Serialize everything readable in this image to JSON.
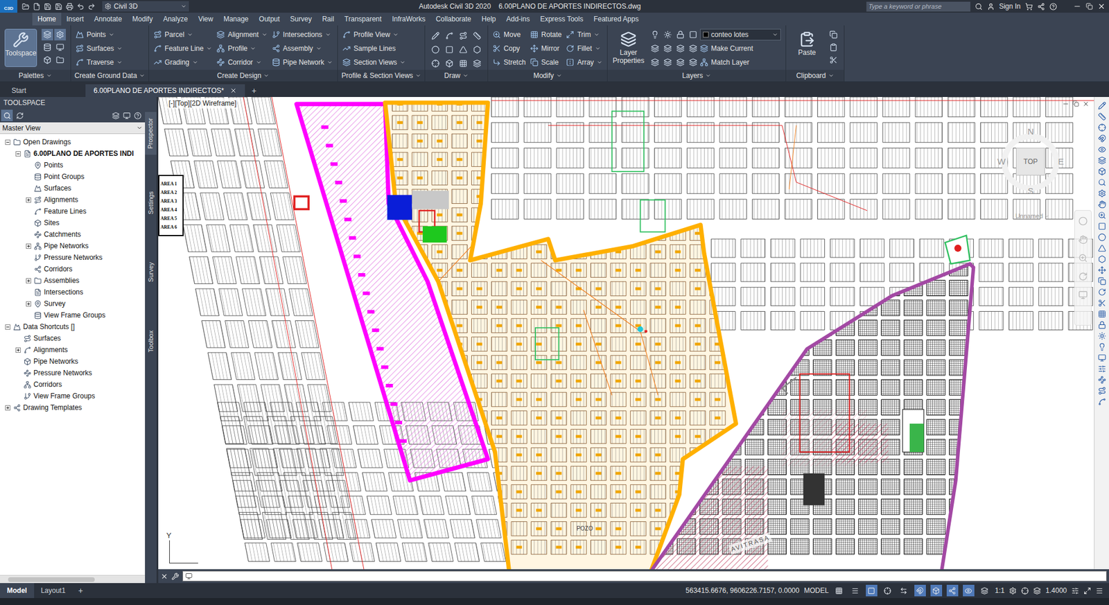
{
  "title_bar": {
    "app_logo": "C3D",
    "workspace": "Civil 3D",
    "title": "Autodesk Civil 3D 2020    6.00PLANO DE APORTES INDIRECTOS.dwg",
    "search_placeholder": "Type a keyword or phrase",
    "sign_in": "Sign In"
  },
  "ribbon_tabs": [
    {
      "label": "Home",
      "selected": true
    },
    {
      "label": "Insert",
      "selected": false
    },
    {
      "label": "Annotate",
      "selected": false
    },
    {
      "label": "Modify",
      "selected": false
    },
    {
      "label": "Analyze",
      "selected": false
    },
    {
      "label": "View",
      "selected": false
    },
    {
      "label": "Manage",
      "selected": false
    },
    {
      "label": "Output",
      "selected": false
    },
    {
      "label": "Survey",
      "selected": false
    },
    {
      "label": "Rail",
      "selected": false
    },
    {
      "label": "Transparent",
      "selected": false
    },
    {
      "label": "InfraWorks",
      "selected": false
    },
    {
      "label": "Collaborate",
      "selected": false
    },
    {
      "label": "Help",
      "selected": false
    },
    {
      "label": "Add-ins",
      "selected": false
    },
    {
      "label": "Express Tools",
      "selected": false
    },
    {
      "label": "Featured Apps",
      "selected": false
    }
  ],
  "ribbon_panels": [
    {
      "title": "Palettes",
      "kind": "palettes",
      "big": {
        "label": "Toolspace",
        "selected": true
      }
    },
    {
      "title": "Create Ground Data",
      "kind": "tools",
      "columns": [
        [
          {
            "label": "Points",
            "dropdown": true
          },
          {
            "label": "Surfaces",
            "dropdown": true
          },
          {
            "label": "Traverse",
            "dropdown": true
          }
        ]
      ]
    },
    {
      "title": "Create Design",
      "kind": "tools",
      "columns": [
        [
          {
            "label": "Parcel",
            "dropdown": true
          },
          {
            "label": "Feature Line",
            "dropdown": true
          },
          {
            "label": "Grading",
            "dropdown": true
          }
        ],
        [
          {
            "label": "Alignment",
            "dropdown": true
          },
          {
            "label": "Profile",
            "dropdown": true
          },
          {
            "label": "Corridor",
            "dropdown": true
          }
        ],
        [
          {
            "label": "Intersections",
            "dropdown": true
          },
          {
            "label": "Assembly",
            "dropdown": true
          },
          {
            "label": "Pipe Network",
            "dropdown": true
          }
        ]
      ]
    },
    {
      "title": "Profile & Section Views",
      "kind": "tools",
      "columns": [
        [
          {
            "label": "Profile View",
            "dropdown": true
          },
          {
            "label": "Sample Lines",
            "dropdown": false
          },
          {
            "label": "Section Views",
            "dropdown": true
          }
        ]
      ]
    },
    {
      "title": "Draw",
      "kind": "icons"
    },
    {
      "title": "Modify",
      "kind": "tools",
      "columns": [
        [
          {
            "label": "Move",
            "dropdown": false
          },
          {
            "label": "Copy",
            "dropdown": false
          },
          {
            "label": "Stretch",
            "dropdown": false
          }
        ],
        [
          {
            "label": "Rotate",
            "dropdown": false
          },
          {
            "label": "Mirror",
            "dropdown": false
          },
          {
            "label": "Scale",
            "dropdown": false
          }
        ],
        [
          {
            "label": "Trim",
            "dropdown": true
          },
          {
            "label": "Fillet",
            "dropdown": true
          },
          {
            "label": "Array",
            "dropdown": true
          }
        ]
      ]
    },
    {
      "title": "Layers",
      "kind": "layers",
      "big": {
        "label": "Layer Properties",
        "selected": false
      },
      "layer": "conteo lotes",
      "columns": [
        [
          {
            "label": "Make Current",
            "dropdown": false
          },
          {
            "label": "Match Layer",
            "dropdown": false
          }
        ]
      ]
    },
    {
      "title": "Clipboard",
      "kind": "clipboard",
      "big": {
        "label": "Paste",
        "selected": false
      }
    }
  ],
  "file_tabs": [
    {
      "label": "Start",
      "selected": false,
      "closable": false
    },
    {
      "label": "6.00PLANO DE APORTES INDIRECTOS*",
      "selected": true,
      "closable": true
    }
  ],
  "new_file_tab": "+",
  "toolspace": {
    "title": "TOOLSPACE",
    "view": "Master View",
    "side_tabs": [
      {
        "label": "Prospector",
        "selected": true
      },
      {
        "label": "Settings",
        "selected": false
      },
      {
        "label": "Survey",
        "selected": false
      },
      {
        "label": "Toolbox",
        "selected": false
      }
    ],
    "tree": [
      {
        "label": "Open Drawings",
        "depth": 0,
        "has_children": true,
        "expanded": true,
        "bold": false
      },
      {
        "label": "6.00PLANO DE APORTES INDI",
        "depth": 1,
        "has_children": true,
        "expanded": true,
        "bold": true
      },
      {
        "label": "Points",
        "depth": 2,
        "has_children": false,
        "expanded": false,
        "bold": false
      },
      {
        "label": "Point Groups",
        "depth": 2,
        "has_children": false,
        "expanded": false,
        "bold": false
      },
      {
        "label": "Surfaces",
        "depth": 2,
        "has_children": false,
        "expanded": false,
        "bold": false
      },
      {
        "label": "Alignments",
        "depth": 2,
        "has_children": true,
        "expanded": false,
        "bold": false
      },
      {
        "label": "Feature Lines",
        "depth": 2,
        "has_children": false,
        "expanded": false,
        "bold": false
      },
      {
        "label": "Sites",
        "depth": 2,
        "has_children": false,
        "expanded": false,
        "bold": false
      },
      {
        "label": "Catchments",
        "depth": 2,
        "has_children": false,
        "expanded": false,
        "bold": false
      },
      {
        "label": "Pipe Networks",
        "depth": 2,
        "has_children": true,
        "expanded": false,
        "bold": false
      },
      {
        "label": "Pressure Networks",
        "depth": 2,
        "has_children": false,
        "expanded": false,
        "bold": false
      },
      {
        "label": "Corridors",
        "depth": 2,
        "has_children": false,
        "expanded": false,
        "bold": false
      },
      {
        "label": "Assemblies",
        "depth": 2,
        "has_children": true,
        "expanded": false,
        "bold": false
      },
      {
        "label": "Intersections",
        "depth": 2,
        "has_children": false,
        "expanded": false,
        "bold": false
      },
      {
        "label": "Survey",
        "depth": 2,
        "has_children": true,
        "expanded": false,
        "bold": false
      },
      {
        "label": "View Frame Groups",
        "depth": 2,
        "has_children": false,
        "expanded": false,
        "bold": false
      },
      {
        "label": "Data Shortcuts []",
        "depth": 0,
        "has_children": true,
        "expanded": true,
        "bold": false
      },
      {
        "label": "Surfaces",
        "depth": 1,
        "has_children": false,
        "expanded": false,
        "bold": false
      },
      {
        "label": "Alignments",
        "depth": 1,
        "has_children": true,
        "expanded": false,
        "bold": false
      },
      {
        "label": "Pipe Networks",
        "depth": 1,
        "has_children": false,
        "expanded": false,
        "bold": false
      },
      {
        "label": "Pressure Networks",
        "depth": 1,
        "has_children": false,
        "expanded": false,
        "bold": false
      },
      {
        "label": "Corridors",
        "depth": 1,
        "has_children": false,
        "expanded": false,
        "bold": false
      },
      {
        "label": "View Frame Groups",
        "depth": 1,
        "has_children": false,
        "expanded": false,
        "bold": false
      },
      {
        "label": "Drawing Templates",
        "depth": 0,
        "has_children": true,
        "expanded": false,
        "bold": false
      }
    ]
  },
  "viewport": {
    "label": "[-][Top][2D Wireframe]",
    "legend": [
      "AREA 1",
      "AREA 2",
      "AREA 3",
      "AREA 4",
      "AREA 5",
      "AREA 6"
    ],
    "compass": {
      "n": "N",
      "s": "S",
      "e": "E",
      "w": "W",
      "top": "TOP"
    },
    "ucs": "Unnamed",
    "annotations": [
      "POZO",
      "AVITRASA"
    ],
    "axis": "Y",
    "zones": [
      {
        "color": "#ff00ff"
      },
      {
        "color": "#ffb000"
      },
      {
        "color": "#a349a4"
      }
    ]
  },
  "status_bar": {
    "layout_tabs": [
      {
        "label": "Model",
        "selected": true
      },
      {
        "label": "Layout1",
        "selected": false
      }
    ],
    "new_layout": "+",
    "coordinates": "563415.6676, 9606226.7157, 0.0000",
    "space": "MODEL",
    "scale": "1:1",
    "lineweight": "1.4000",
    "toggles": [
      {
        "on": false
      },
      {
        "on": false
      },
      {
        "on": true
      },
      {
        "on": false
      },
      {
        "on": false
      },
      {
        "on": true
      },
      {
        "on": true
      },
      {
        "on": true
      },
      {
        "on": true
      },
      {
        "on": false
      }
    ]
  }
}
